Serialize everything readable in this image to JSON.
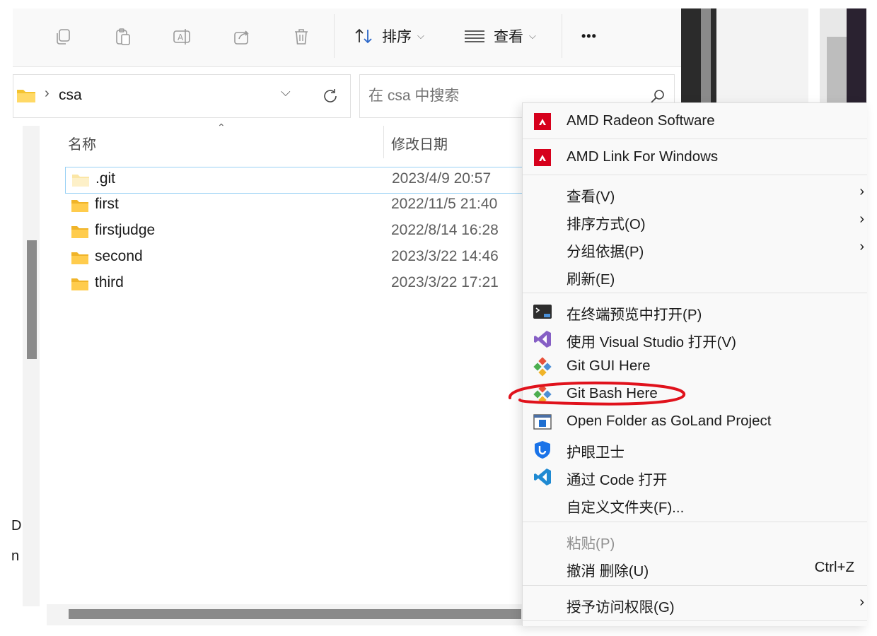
{
  "toolbar": {
    "sort_label": "排序",
    "view_label": "查看",
    "more_label": "•••"
  },
  "address": {
    "path": "csa",
    "separator": "›"
  },
  "search": {
    "placeholder": "在 csa 中搜索"
  },
  "columns": {
    "name": "名称",
    "modified": "修改日期"
  },
  "files": [
    {
      "name": ".git",
      "date": "2023/4/9 20:57",
      "selected": true
    },
    {
      "name": "first",
      "date": "2022/11/5 21:40"
    },
    {
      "name": "firstjudge",
      "date": "2022/8/14 16:28"
    },
    {
      "name": "second",
      "date": "2023/3/22 14:46"
    },
    {
      "name": "third",
      "date": "2023/3/22 17:21"
    }
  ],
  "context_menu": {
    "items": [
      {
        "label": "AMD Radeon Software",
        "icon": "amd-icon"
      },
      {
        "label": "AMD Link For Windows",
        "icon": "amd-icon"
      },
      {
        "label": "查看(V)",
        "submenu": true
      },
      {
        "label": "排序方式(O)",
        "submenu": true
      },
      {
        "label": "分组依据(P)",
        "submenu": true
      },
      {
        "label": "刷新(E)"
      },
      {
        "label": "在终端预览中打开(P)",
        "icon": "terminal-icon"
      },
      {
        "label": "使用 Visual Studio 打开(V)",
        "icon": "visual-studio-icon"
      },
      {
        "label": "Git GUI Here",
        "icon": "git-icon"
      },
      {
        "label": "Git Bash Here",
        "icon": "git-icon"
      },
      {
        "label": "Open Folder as GoLand Project",
        "icon": "goland-icon"
      },
      {
        "label": "护眼卫士",
        "icon": "shield-icon"
      },
      {
        "label": "通过 Code 打开",
        "icon": "vscode-icon"
      },
      {
        "label": "自定义文件夹(F)..."
      },
      {
        "label": "粘贴(P)",
        "disabled": true
      },
      {
        "label": "撤消 删除(U)",
        "shortcut": "Ctrl+Z"
      },
      {
        "label": "授予访问权限(G)",
        "submenu": true
      }
    ],
    "arrow": "›"
  },
  "sidebar_fragments": [
    "D",
    "n"
  ],
  "colors": {
    "amd_red": "#d6001c",
    "folder_yellow": "#f4c430",
    "annotation_red": "#e0121c",
    "selection_border": "#99d1f5"
  }
}
